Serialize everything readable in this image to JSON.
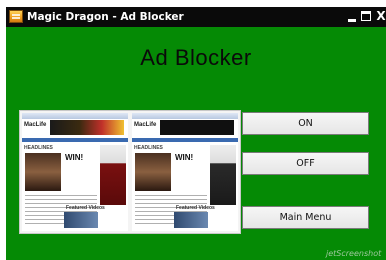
{
  "window": {
    "title": "Magic Dragon - Ad Blocker",
    "icon": "app-icon",
    "controls": {
      "minimize": "minimize-icon",
      "maximize": "maximize-icon",
      "close_label": "X"
    }
  },
  "main": {
    "heading": "Ad Blocker",
    "preview": {
      "description_icon": "website-preview-image",
      "logo_text": "MacLife",
      "headline": "HEADLINES",
      "win_text": "WIN!",
      "video_label": "Featured Videos"
    }
  },
  "buttons": {
    "on_label": "ON",
    "off_label": "OFF",
    "main_menu_label": "Main Menu"
  },
  "watermark": {
    "text": "jetScreenshot"
  },
  "colors": {
    "window_background": "#058a05",
    "titlebar": "#0a0a0a",
    "button_background": "#f0f0f0",
    "heading_text": "#0a0a0a"
  }
}
